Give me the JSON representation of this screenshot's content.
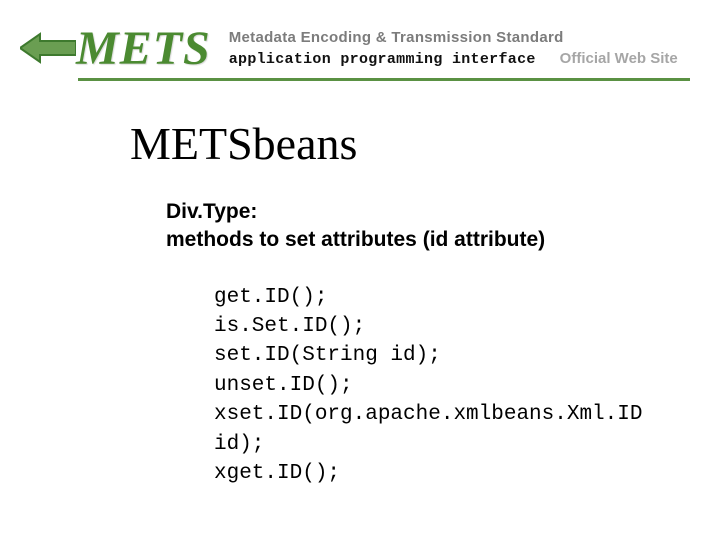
{
  "header": {
    "logo_text": "METS",
    "tagline": "Metadata Encoding & Transmission Standard",
    "subtag": "application programming interface",
    "official": "Official Web Site"
  },
  "page": {
    "title": "METSbeans",
    "subtitle_line1": "Div.Type:",
    "subtitle_line2": "methods to set attributes (id attribute)",
    "code": "get.ID();\nis.Set.ID();\nset.ID(String id);\nunset.ID();\nxset.ID(org.apache.xmlbeans.Xml.ID\nid);\nxget.ID();"
  }
}
